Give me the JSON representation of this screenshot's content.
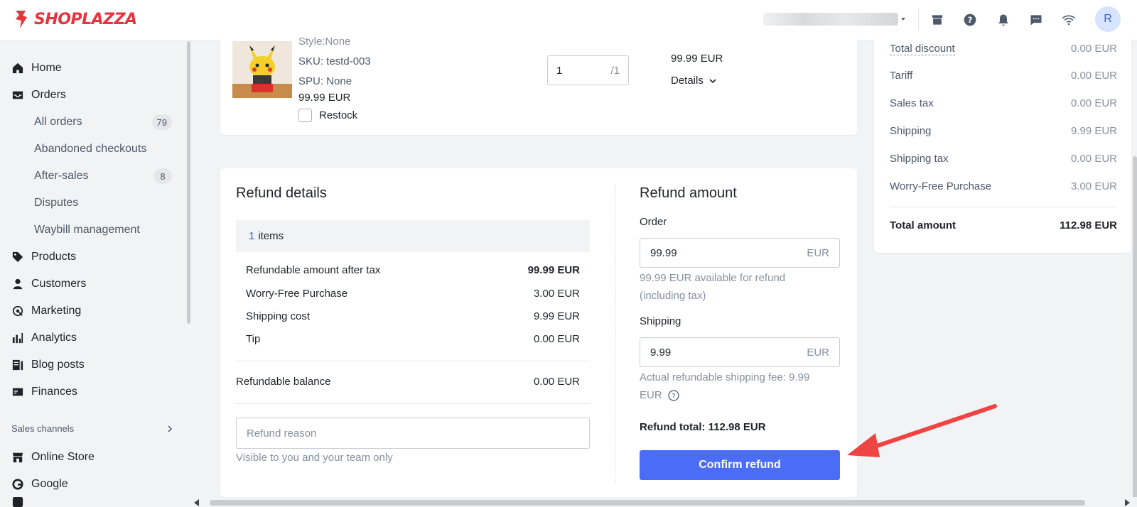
{
  "brand": {
    "name": "SHOPLAZZA",
    "color": "#e8323c"
  },
  "topbar": {
    "icons": [
      "store-icon",
      "help-icon",
      "bell-icon",
      "message-icon",
      "wifi-icon"
    ],
    "avatar_initial": "R"
  },
  "sidebar": {
    "home": "Home",
    "orders": "Orders",
    "all_orders": "All orders",
    "all_orders_count": "79",
    "abandoned": "Abandoned checkouts",
    "after_sales": "After-sales",
    "after_sales_count": "8",
    "disputes": "Disputes",
    "waybill": "Waybill management",
    "products": "Products",
    "customers": "Customers",
    "marketing": "Marketing",
    "analytics": "Analytics",
    "blog_posts": "Blog posts",
    "finances": "Finances",
    "sales_channels": "Sales channels",
    "online_store": "Online Store",
    "google": "Google"
  },
  "product": {
    "style": "Style:None",
    "sku": "SKU: testd-003",
    "spu": "SPU: None",
    "price": "99.99 EUR",
    "restock_label": "Restock",
    "qty_value": "1",
    "qty_max": "/1",
    "line_total": "99.99 EUR",
    "details_label": "Details"
  },
  "refund_details": {
    "title": "Refund details",
    "items_count": "1",
    "items_label": "items",
    "rows": [
      {
        "label": "Refundable amount after tax",
        "value": "99.99 EUR"
      },
      {
        "label": "Worry-Free Purchase",
        "value": "3.00 EUR"
      },
      {
        "label": "Shipping cost",
        "value": "9.99 EUR"
      },
      {
        "label": "Tip",
        "value": "0.00 EUR"
      }
    ],
    "balance_label": "Refundable balance",
    "balance_value": "0.00 EUR",
    "reason_placeholder": "Refund reason",
    "reason_help": "Visible to you and your team only"
  },
  "refund_amount": {
    "title": "Refund amount",
    "order_label": "Order",
    "order_value": "99.99",
    "currency": "EUR",
    "order_help_1": "99.99 EUR available for refund",
    "order_help_2": "(including tax)",
    "shipping_label": "Shipping",
    "shipping_value": "9.99",
    "shipping_help_1": "Actual refundable shipping fee: 9.99",
    "shipping_help_2": "EUR",
    "total_text": "Refund total: 112.98 EUR",
    "confirm_label": "Confirm refund",
    "confirm_color": "#4a6cf7"
  },
  "summary": {
    "rows": [
      {
        "label": "Total discount",
        "value": "0.00 EUR"
      },
      {
        "label": "Tariff",
        "value": "0.00 EUR"
      },
      {
        "label": "Sales tax",
        "value": "0.00 EUR"
      },
      {
        "label": "Shipping",
        "value": "9.99 EUR"
      },
      {
        "label": "Shipping tax",
        "value": "0.00 EUR"
      },
      {
        "label": "Worry-Free Purchase",
        "value": "3.00 EUR"
      }
    ],
    "total_label": "Total amount",
    "total_value": "112.98 EUR"
  },
  "annotation": {
    "arrow_color": "#ef4444"
  }
}
